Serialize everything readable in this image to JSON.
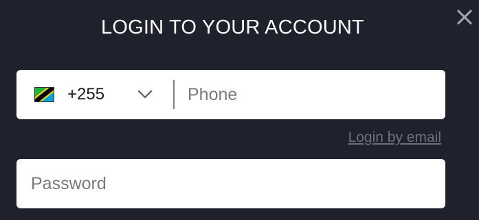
{
  "modal": {
    "title": "LOGIN TO YOUR ACCOUNT",
    "close_icon": "close-icon"
  },
  "phone": {
    "flag_icon": "tanzania-flag-icon",
    "country_code": "+255",
    "dropdown_icon": "chevron-down-icon",
    "placeholder": "Phone",
    "value": ""
  },
  "login_by_email_label": "Login by email",
  "password": {
    "placeholder": "Password",
    "value": ""
  },
  "colors": {
    "background": "#1f212d",
    "field_background": "#ffffff",
    "link": "#6e717d",
    "close_icon": "#9ea2ae"
  }
}
